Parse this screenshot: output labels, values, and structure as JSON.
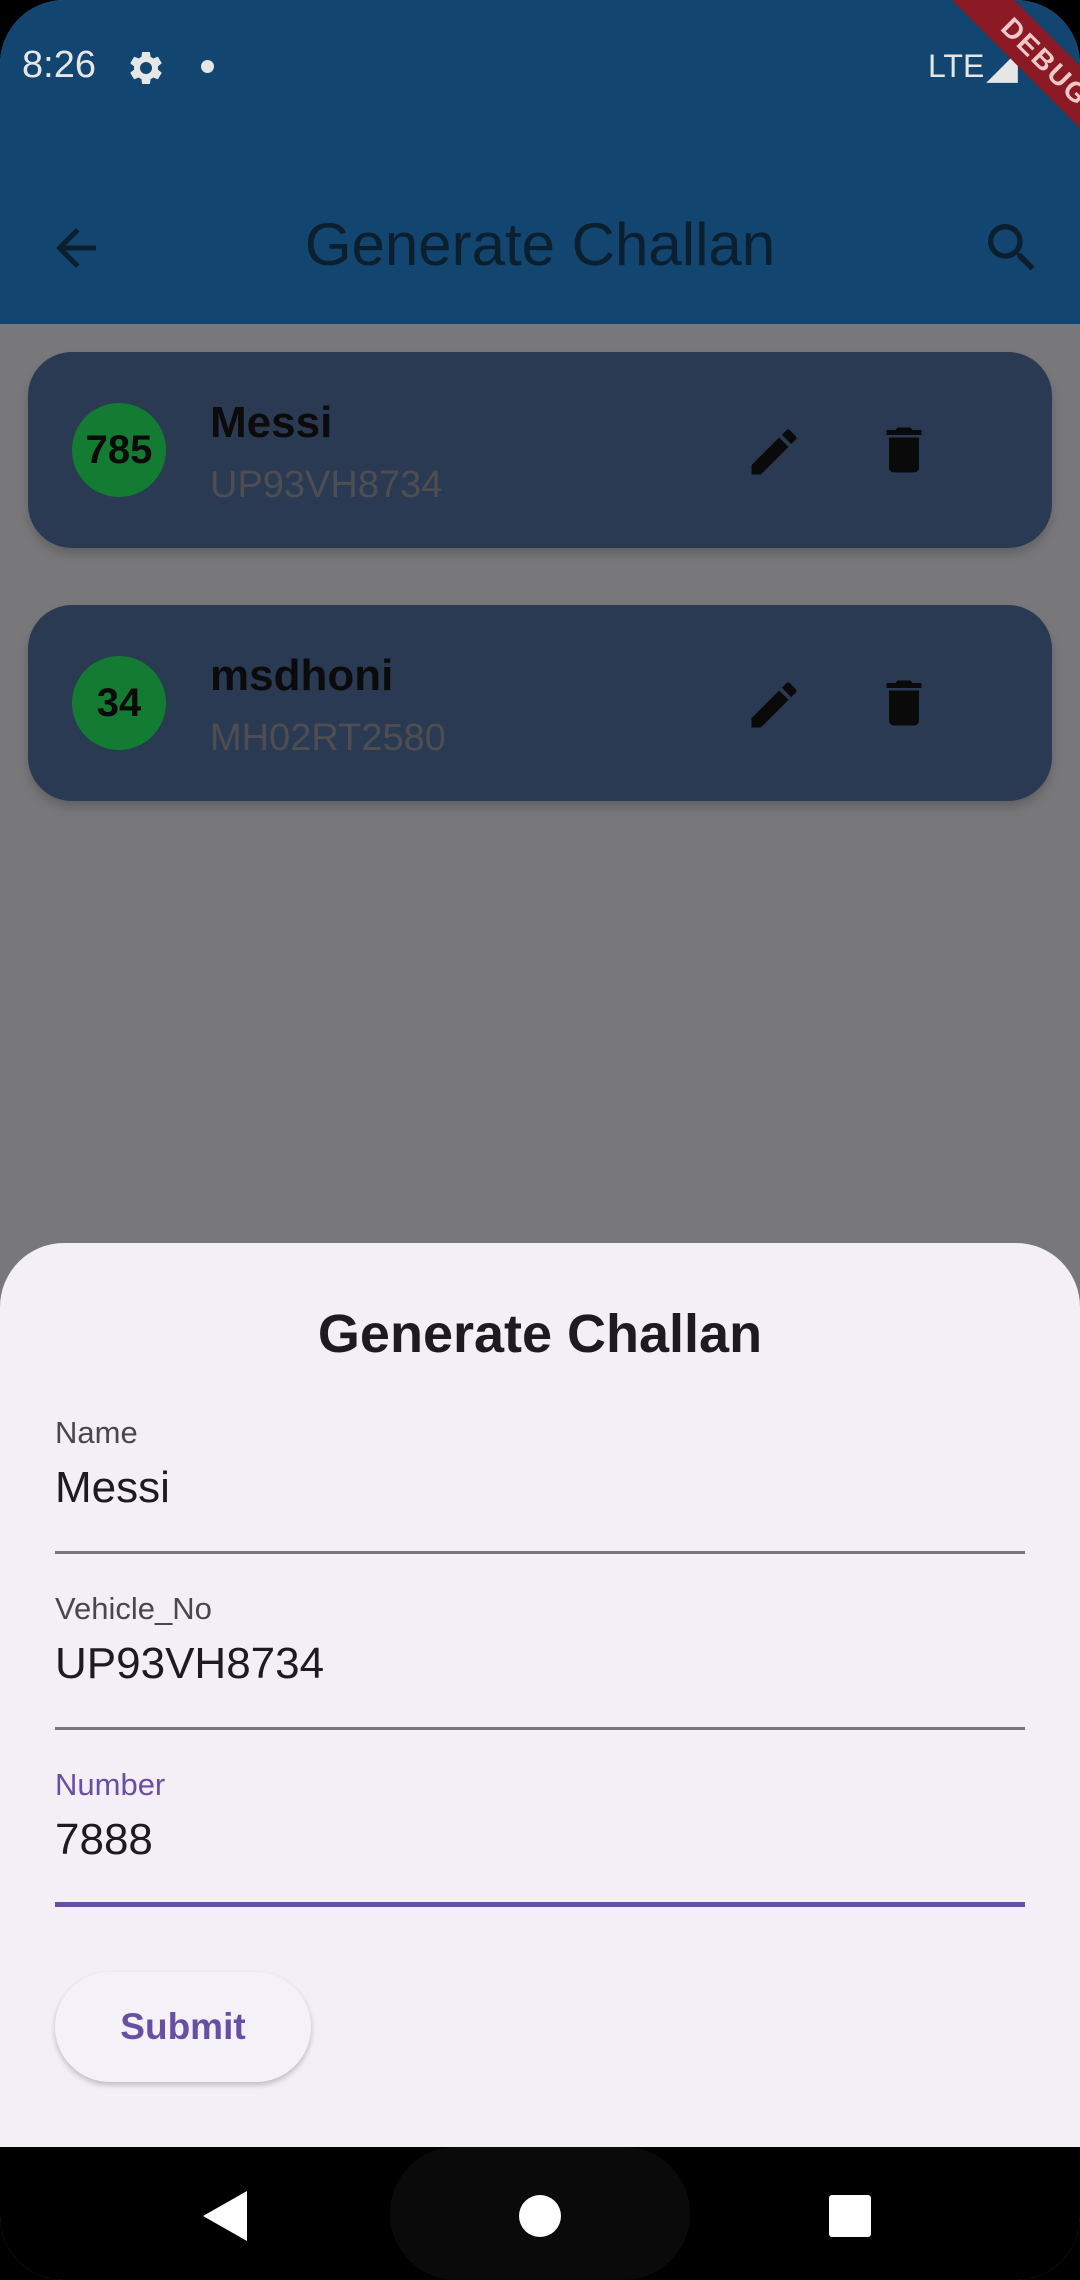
{
  "status_bar": {
    "time": "8:26",
    "network": "LTE",
    "debug_label": "DEBUG"
  },
  "app_bar": {
    "title": "Generate Challan"
  },
  "list": {
    "items": [
      {
        "number": "785",
        "name": "Messi",
        "vehicle": "UP93VH8734"
      },
      {
        "number": "34",
        "name": "msdhoni",
        "vehicle": "MH02RT2580"
      }
    ]
  },
  "sheet": {
    "title": "Generate Challan",
    "fields": [
      {
        "label": "Name",
        "value": "Messi"
      },
      {
        "label": "Vehicle_No",
        "value": "UP93VH8734"
      },
      {
        "label": "Number",
        "value": "7888"
      }
    ],
    "submit_label": "Submit"
  },
  "colors": {
    "accent": "#6750a4",
    "avatar": "#137c32",
    "app_bar": "#12456f",
    "card": "#2a3a53"
  }
}
